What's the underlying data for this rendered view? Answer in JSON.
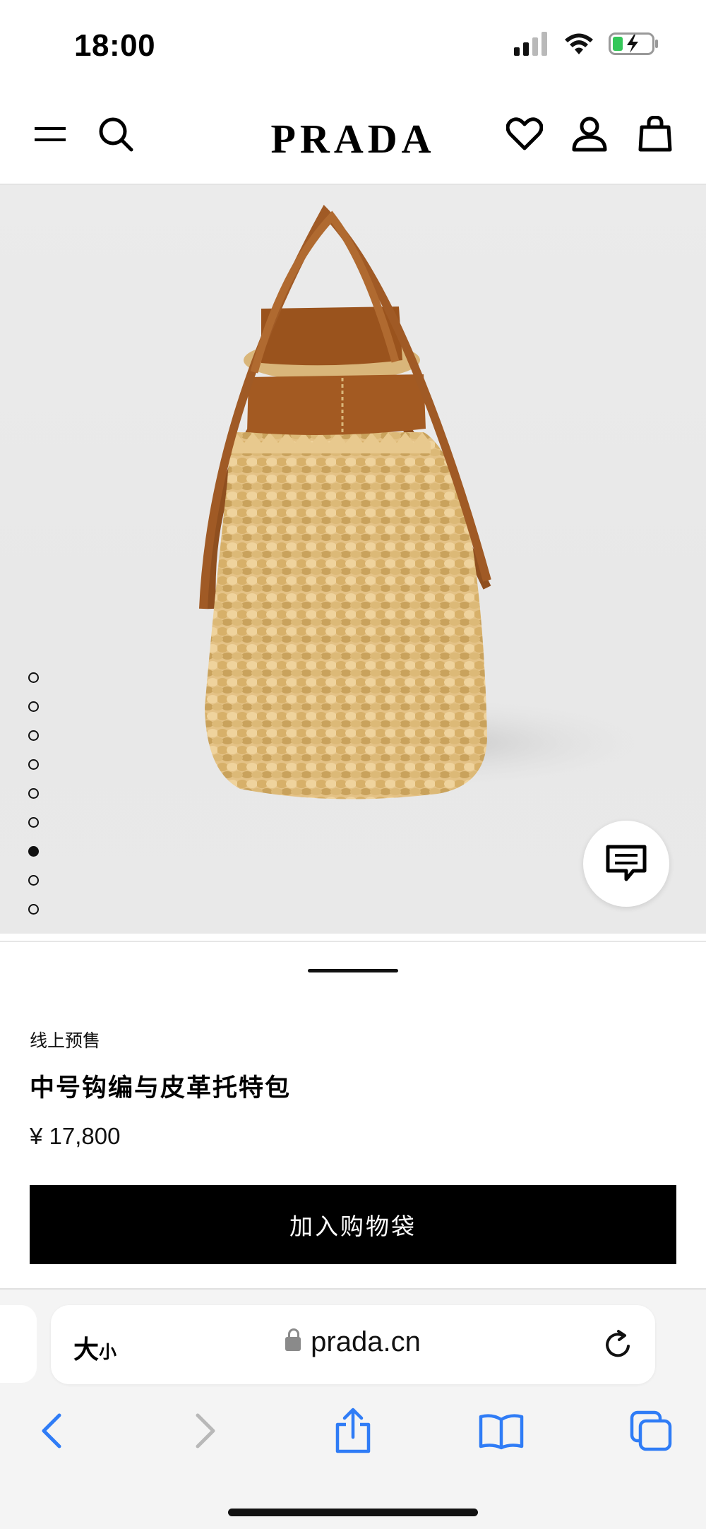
{
  "status_bar": {
    "time": "18:00"
  },
  "header": {
    "menu_icon": "menu-icon",
    "search_icon": "search-icon",
    "logo": "PRADA",
    "wishlist_icon": "heart-icon",
    "account_icon": "user-icon",
    "bag_icon": "shopping-bag-icon"
  },
  "gallery": {
    "image_count": 9,
    "active_index": 6,
    "chat_icon": "chat-icon"
  },
  "product": {
    "tag": "线上预售",
    "name": "中号钩编与皮革托特包",
    "price": "¥ 17,800",
    "add_to_bag_label": "加入购物袋"
  },
  "browser": {
    "text_size_label_big": "大",
    "text_size_label_small": "小",
    "url": "prada.cn",
    "toolbar_icons": [
      "back-icon",
      "forward-icon",
      "share-icon",
      "bookmarks-icon",
      "tabs-icon"
    ]
  },
  "colors": {
    "accent_blue": "#2f7cf6",
    "button_black": "#000000",
    "hero_bg": "#e9e9e9"
  }
}
